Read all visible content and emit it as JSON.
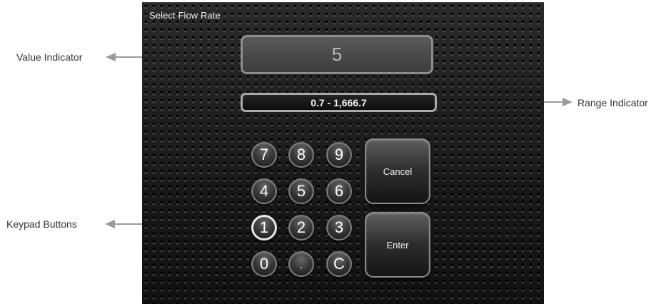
{
  "screen": {
    "title": "Select Flow Rate",
    "value": "5",
    "range": "0.7 - 1,666.7"
  },
  "keypad": {
    "keys": [
      "7",
      "8",
      "9",
      "4",
      "5",
      "6",
      "1",
      "2",
      "3",
      "0",
      ".",
      "C"
    ],
    "cancel_label": "Cancel",
    "enter_label": "Enter",
    "selected_key": "1"
  },
  "annotations": {
    "value_indicator": "Value Indicator",
    "range_indicator": "Range Indicator",
    "keypad_buttons": "Keypad Buttons"
  },
  "colors": {
    "screen_background": "#1c1c1c",
    "annotation_arrow": "#9a9a9a",
    "key_text": "#ffffff"
  }
}
